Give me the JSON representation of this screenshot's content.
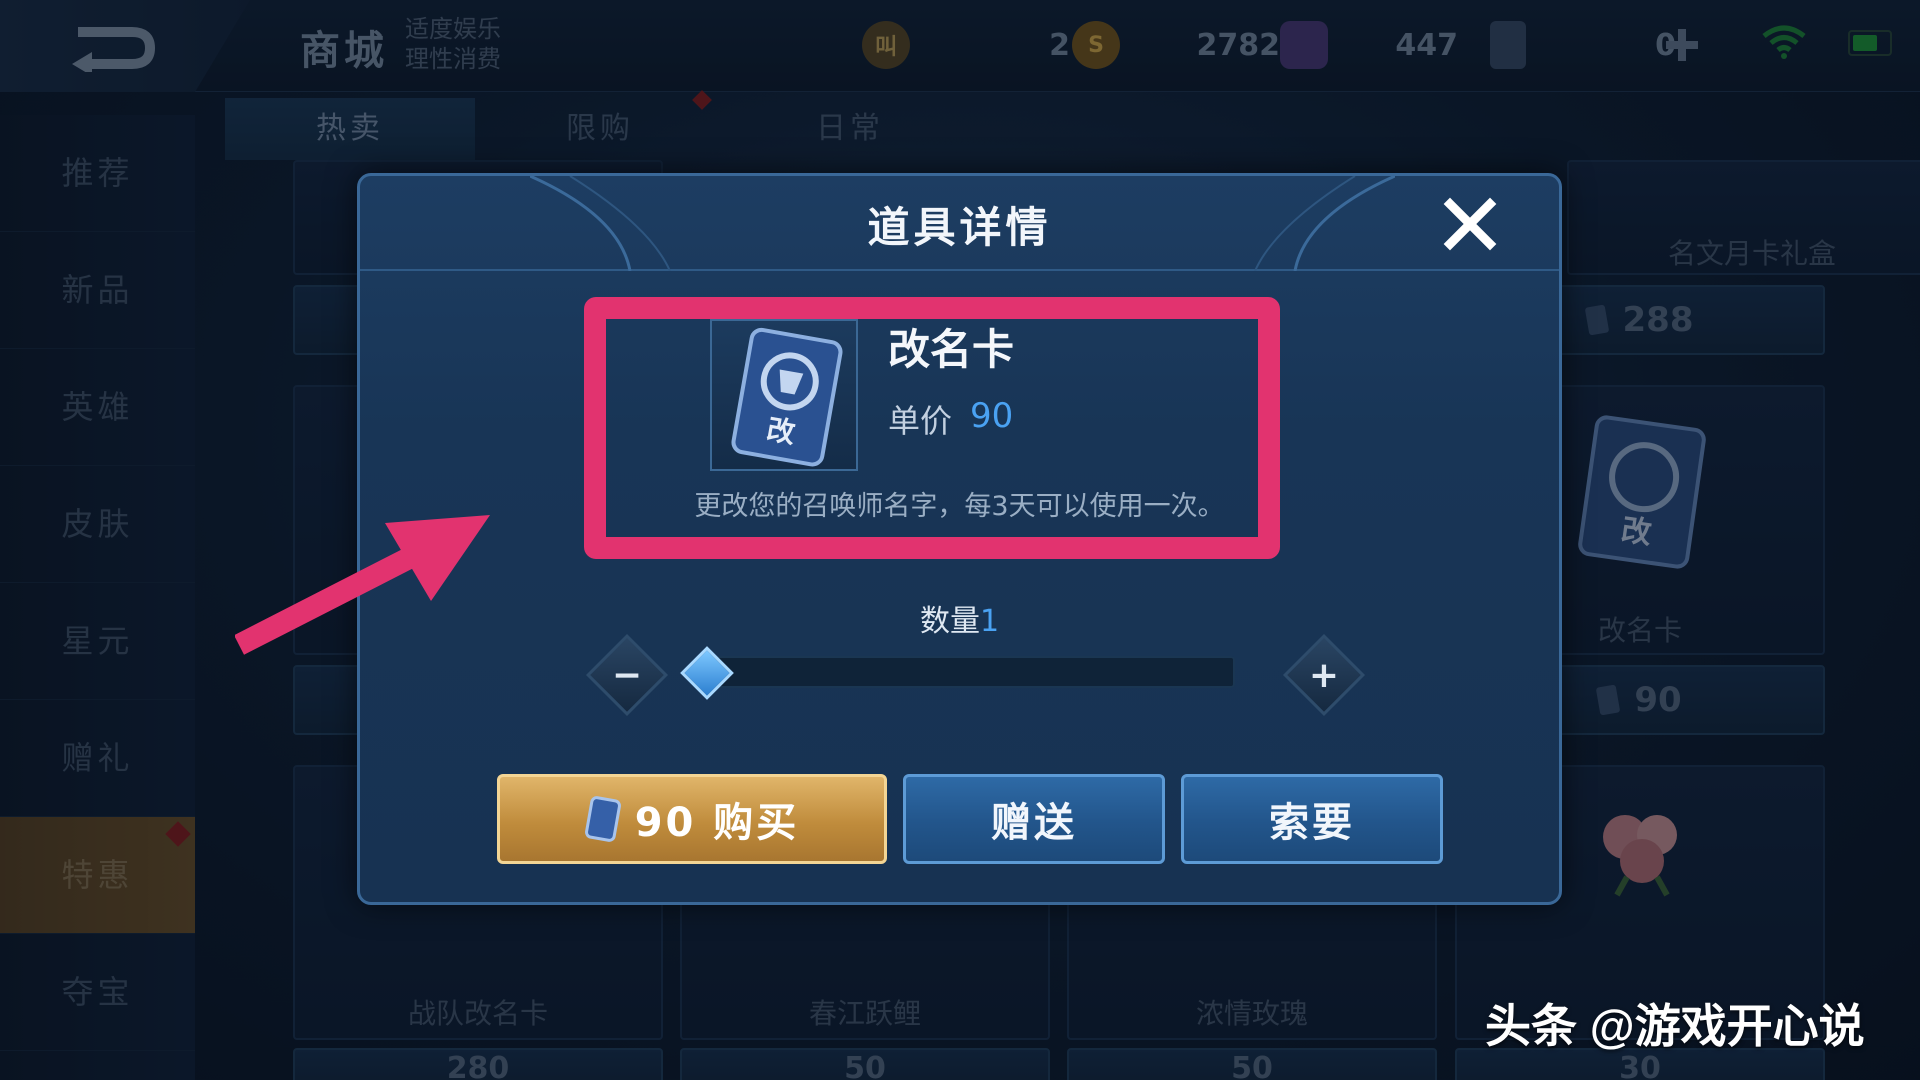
{
  "header": {
    "title": "商城",
    "slogan_line1": "适度娱乐",
    "slogan_line2": "理性消费"
  },
  "currencies": [
    {
      "icon": "honor-coin-icon",
      "glyph": "叫",
      "value": "2"
    },
    {
      "icon": "gold-coin-icon",
      "glyph": "S",
      "value": "2782"
    },
    {
      "icon": "diamond-icon",
      "glyph": "",
      "value": "447"
    },
    {
      "icon": "rename-voucher-icon",
      "glyph": "",
      "value": "0"
    }
  ],
  "tabs": [
    {
      "label": "热卖",
      "active": true
    },
    {
      "label": "限购",
      "active": false
    },
    {
      "label": "日常",
      "active": false
    }
  ],
  "sidebar": {
    "items": [
      {
        "label": "推荐"
      },
      {
        "label": "新品"
      },
      {
        "label": "英雄"
      },
      {
        "label": "皮肤"
      },
      {
        "label": "星元"
      },
      {
        "label": "赠礼"
      },
      {
        "label": "特惠",
        "active": true
      },
      {
        "label": "夺宝"
      }
    ]
  },
  "background_cards": {
    "top_right_name": "名文月卡礼盒",
    "top_right_price": "288",
    "mid_right_name": "改名卡",
    "mid_right_price": "90",
    "bottom_names": [
      "战队改名卡",
      "春江跃鲤",
      "浓情玫瑰"
    ],
    "bottom_prices": [
      "280",
      "50",
      "50",
      "30"
    ]
  },
  "modal": {
    "title": "道具详情",
    "item_name": "改名卡",
    "card_glyph": "改",
    "price_label": "单价",
    "price_value": "90",
    "description": "更改您的召唤师名字，每3天可以使用一次。",
    "quantity_label": "数量",
    "quantity_value": "1",
    "buy_label": "90 购买",
    "gift_label": "赠送",
    "ask_label": "索要"
  },
  "watermark": "头条 @游戏开心说",
  "colors": {
    "accent_blue": "#4aa2f2",
    "highlight_pink": "#e2336f",
    "buy_gold": "#c08c3c"
  }
}
